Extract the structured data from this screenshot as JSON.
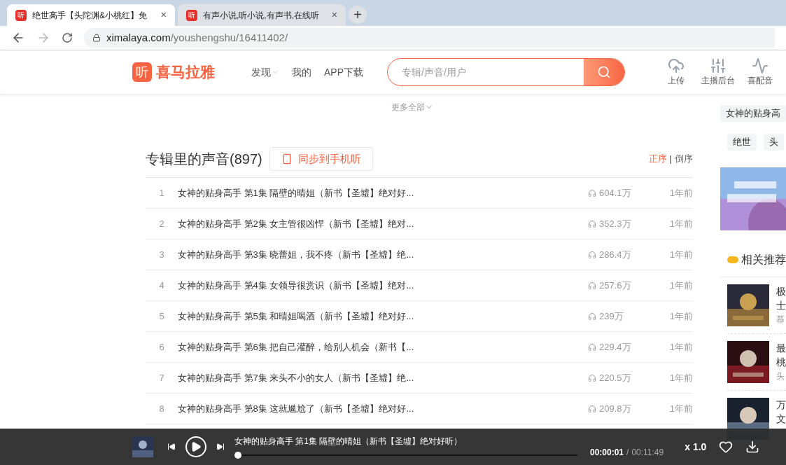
{
  "browser": {
    "tabs": [
      {
        "favicon": "听",
        "title": "绝世高手【头陀渊&小桃红】免",
        "selected": true,
        "close": "×"
      },
      {
        "favicon": "听",
        "title": "有声小说,听小说,有声书,在线听",
        "selected": false,
        "close": "×"
      }
    ],
    "new_tab": "+",
    "url_host": "ximalaya.com",
    "url_path": "/youshengshu/16411402/"
  },
  "header": {
    "logo_mark": "听",
    "logo_text": "喜马拉雅",
    "nav": [
      {
        "label": "发现",
        "dropdown": true
      },
      {
        "label": "我的",
        "dropdown": false
      },
      {
        "label": "APP下载",
        "dropdown": false
      }
    ],
    "search": {
      "placeholder": "专辑/声音/用户"
    },
    "actions": [
      {
        "kind": "upload",
        "label": "上传"
      },
      {
        "kind": "studio",
        "label": "主播后台"
      },
      {
        "kind": "dub",
        "label": "喜配音"
      }
    ]
  },
  "more": "更多全部",
  "tracks_section": {
    "title": "专辑里的声音(897)",
    "sync_button": "同步到手机听",
    "sort": [
      {
        "label": "正序",
        "selected": true
      },
      {
        "label": "倒序",
        "selected": false
      }
    ],
    "sort_divider": "|"
  },
  "tracks": [
    {
      "index": "1",
      "title": "女神的贴身高手 第1集 隔壁的晴姐（新书【圣墟】绝对好...",
      "plays": "604.1万",
      "date": "1年前"
    },
    {
      "index": "2",
      "title": "女神的贴身高手 第2集 女主管很凶悍（新书【圣墟】绝对...",
      "plays": "352.3万",
      "date": "1年前"
    },
    {
      "index": "3",
      "title": "女神的贴身高手 第3集 晓蕾姐，我不疼（新书【圣墟】绝...",
      "plays": "286.4万",
      "date": "1年前"
    },
    {
      "index": "4",
      "title": "女神的贴身高手 第4集 女领导很赏识（新书【圣墟】绝对...",
      "plays": "257.6万",
      "date": "1年前"
    },
    {
      "index": "5",
      "title": "女神的贴身高手 第5集 和晴姐喝酒（新书【圣墟】绝对好...",
      "plays": "239万",
      "date": "1年前"
    },
    {
      "index": "6",
      "title": "女神的贴身高手 第6集 把自己灌醉，给别人机会（新书【...",
      "plays": "229.4万",
      "date": "1年前"
    },
    {
      "index": "7",
      "title": "女神的贴身高手 第7集 来头不小的女人（新书【圣墟】绝...",
      "plays": "220.5万",
      "date": "1年前"
    },
    {
      "index": "8",
      "title": "女神的贴身高手 第8集 这就尴尬了（新书【圣墟】绝对好...",
      "plays": "209.8万",
      "date": "1年前"
    }
  ],
  "sidebar": {
    "tags": [
      {
        "label": "女神的贴身高"
      },
      {
        "label": "绝世"
      },
      {
        "label": "头"
      }
    ],
    "related_title": "相关推荐",
    "related": [
      {
        "line_1": "极",
        "line_2": "士",
        "line_3": "慕"
      },
      {
        "line_1": "最",
        "line_2": "桃",
        "line_3": "头"
      },
      {
        "line_1": "万",
        "line_2": "文"
      }
    ]
  },
  "player": {
    "title": "女神的贴身高手 第1集 隔壁的晴姐（新书【圣墟】绝对好听）",
    "playing": false,
    "level": 0.0,
    "elapsed": "00:00:01",
    "separator": "/",
    "total": "00:11:49",
    "speed": "x 1.0"
  }
}
